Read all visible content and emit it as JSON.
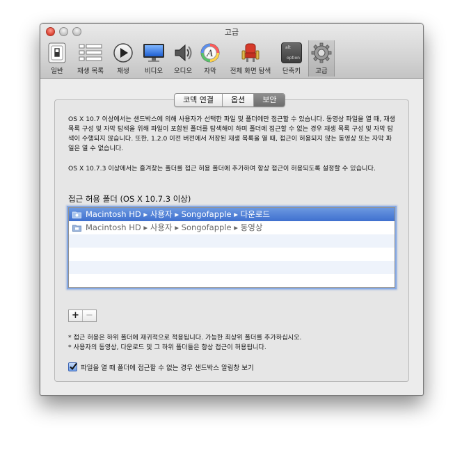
{
  "window": {
    "title": "고급"
  },
  "toolbar": {
    "items": [
      {
        "label": "일반",
        "icon": "general-switch-icon"
      },
      {
        "label": "재생 목록",
        "icon": "playlist-icon"
      },
      {
        "label": "재생",
        "icon": "play-icon"
      },
      {
        "label": "비디오",
        "icon": "monitor-icon"
      },
      {
        "label": "오디오",
        "icon": "speaker-icon"
      },
      {
        "label": "자막",
        "icon": "subtitle-color-icon"
      },
      {
        "label": "전체 화면 탐색",
        "icon": "theater-seat-icon"
      },
      {
        "label": "단축키",
        "icon": "keyboard-key-icon"
      },
      {
        "label": "고급",
        "icon": "gear-icon",
        "selected": true
      }
    ],
    "key_icon_top": "alt",
    "key_icon_bottom": "option"
  },
  "tabs": {
    "items": [
      "코덱 연결",
      "옵션",
      "보안"
    ],
    "selected": "보안"
  },
  "security": {
    "desc1": "OS X 10.7 이상에서는 샌드박스에 의해 사용자가 선택한 파일 및 폴더에만 접근할 수 있습니다. 동영상 파일을 열 때, 재생 목록 구성 및 자막 탐색을 위해 파일이 포함된 폴더를 탐색해야 하며 폴더에 접근할 수 없는 경우 재생 목록 구성 및 자막 탐색이 수행되지 않습니다. 또한, 1.2.0 이전 버전에서 저장된 재생 목록을 열 때, 접근이 허용되지 않는 동영상 또는 자막 파일은 열 수 없습니다.",
    "desc2": "OS X 10.7.3 이상에서는 즐겨찾는 폴더를 접근 허용 폴더에 추가하여 항상 접근이 허용되도록 설정할 수 있습니다.",
    "section_title": "접근 허용 폴더 (OS X 10.7.3 이상)",
    "folders": [
      "Macintosh HD ▸ 사용자 ▸ Songofapple ▸ 다운로드",
      "Macintosh HD ▸ 사용자 ▸ Songofapple ▸ 동영상"
    ],
    "selected_folder": 0,
    "add_label": "+",
    "remove_label": "−",
    "note1": "* 접근 허용은 하위 폴더에 재귀적으로 적용됩니다. 가능한 최상위 폴더를 추가하십시오.",
    "note2": "* 사용자의 동영상, 다운로드 및 그 하위 폴더들은 항상 접근이 허용됩니다.",
    "checkbox_label": "파일을 열 때 폴더에 접근할 수 없는 경우 샌드박스 알림창 보기",
    "checkbox_checked": true
  },
  "colors": {
    "selection": "#3f70cf",
    "focus_ring": "#86a9e3",
    "close_button": "#d9402f"
  }
}
